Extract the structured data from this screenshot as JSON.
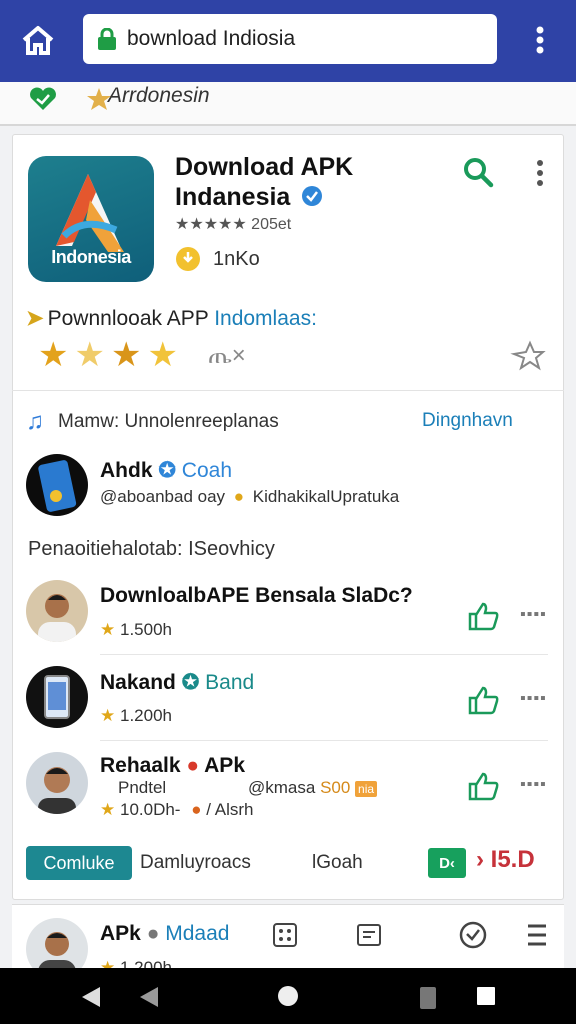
{
  "browser": {
    "url_text": "bownload Indiosia",
    "sub_label": "Arrdonesin"
  },
  "app": {
    "icon_label": "Indonesia",
    "title": "Download APK Indanesia",
    "rating_text": "★★★★★ 205et",
    "coins_text": "1nKo",
    "promo_prefix": "Pownnlooak APP",
    "promo_highlight": "Indomlaas:",
    "promo_stars": [
      "★",
      "★",
      "★",
      "★"
    ],
    "thumb_text": "ጤ×"
  },
  "section": {
    "header_text": "Mamw: Unnolenreeplanas",
    "header_link": "Dingnhavn",
    "sub_header": "Penaoitiehalotab: ISeovhicy"
  },
  "featured": {
    "title": "Ahdk",
    "tag": "Coah",
    "meta_left": "@aboanbad oay",
    "meta_right": "KidhakikalUpratuka"
  },
  "items": [
    {
      "title": "DownloalbAPE Bensala SlaDc?",
      "rating": "1.500h"
    },
    {
      "title": "Nakand",
      "tag": "Band",
      "rating": "1.200h"
    },
    {
      "title": "Rehaalk",
      "tag": "APk",
      "line2_left": "Pndtel",
      "line2_right": "@kmasa",
      "line2_num": "S00",
      "badge": "nia",
      "rating": "10.0Dh-",
      "extra": "/ Alsrh"
    }
  ],
  "footer": {
    "chip": "Comluke",
    "link1": "Damluyroacs",
    "link2": "lGoah",
    "btn": "D‹",
    "red": "› I5.D"
  },
  "bottom_row": {
    "title": "APk",
    "tag": "Mdaad",
    "rating": "1.200h"
  },
  "colors": {
    "topbar": "#2f43a6",
    "accent_green": "#17a05d",
    "link_blue": "#1b7fb8",
    "teal": "#1d8891"
  }
}
